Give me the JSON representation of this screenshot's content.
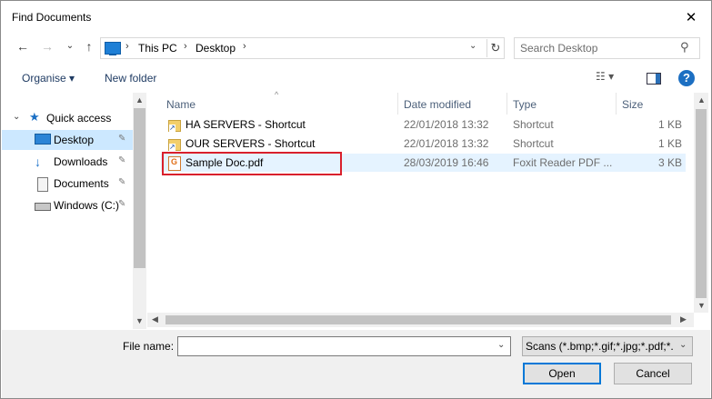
{
  "window": {
    "title": "Find Documents",
    "close_glyph": "✕"
  },
  "nav": {
    "back": "←",
    "forward": "→",
    "recent": "⌄",
    "up": "↑"
  },
  "address": {
    "crumbs": [
      "This PC",
      "Desktop"
    ],
    "separator": "›",
    "refresh": "↻"
  },
  "search": {
    "placeholder": "Search Desktop"
  },
  "toolbar": {
    "organise": "Organise ▾",
    "new_folder": "New folder",
    "views": "☷ ▾",
    "help": "?"
  },
  "sidebar": {
    "items": [
      {
        "label": "Quick access",
        "icon": "star-icon"
      },
      {
        "label": "Desktop",
        "icon": "desktop-icon",
        "pinned": true
      },
      {
        "label": "Downloads",
        "icon": "download-icon",
        "pinned": true
      },
      {
        "label": "Documents",
        "icon": "documents-icon",
        "pinned": true
      },
      {
        "label": "Windows (C:)",
        "icon": "drive-icon",
        "pinned": true
      }
    ],
    "pin_glyph": "📌"
  },
  "list": {
    "columns": [
      "Name",
      "Date modified",
      "Type",
      "Size"
    ],
    "rows": [
      {
        "name": "HA SERVERS - Shortcut",
        "date": "22/01/2018 13:32",
        "type": "Shortcut",
        "size": "1 KB",
        "icon": "folder-shortcut-icon"
      },
      {
        "name": "OUR SERVERS - Shortcut",
        "date": "22/01/2018 13:32",
        "type": "Shortcut",
        "size": "1 KB",
        "icon": "folder-shortcut-icon"
      },
      {
        "name": "Sample Doc.pdf",
        "date": "28/03/2019 16:46",
        "type": "Foxit Reader PDF ...",
        "size": "3 KB",
        "icon": "pdf-icon"
      }
    ]
  },
  "footer": {
    "file_name_label": "File name:",
    "file_name_value": "",
    "filter": "Scans (*.bmp;*.gif;*.jpg;*.pdf;*.",
    "open": "Open",
    "cancel": "Cancel"
  },
  "colors": {
    "accent": "#0078d7",
    "selection": "#cce8ff",
    "row_selected": "#e5f3ff",
    "highlight_box": "#d9202c"
  }
}
